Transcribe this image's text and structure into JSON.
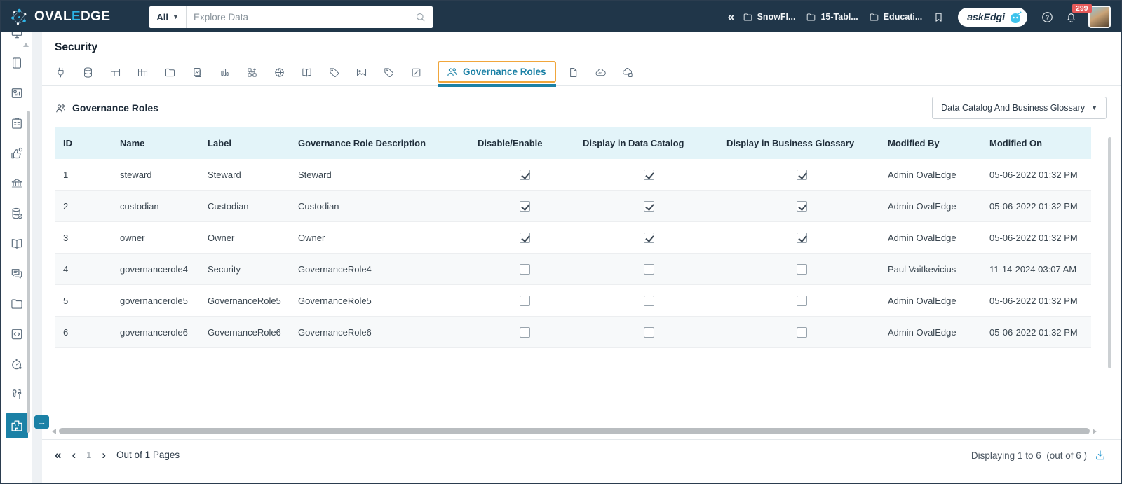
{
  "colors": {
    "navbar_bg": "#203649",
    "accent_cyan": "#2cb5e8",
    "accent_teal": "#1b81a6",
    "highlight_orange": "#f0a63c",
    "badge_red": "#e65a5a",
    "table_header_bg": "#e3f4f9"
  },
  "navbar": {
    "brand": {
      "part1": "OVAL",
      "accent": "E",
      "part2": "DGE"
    },
    "search": {
      "scope_label": "All",
      "placeholder": "Explore Data"
    },
    "recent_items": [
      "SnowFl...",
      "15-Tabl...",
      "Educati..."
    ],
    "ask_edgi_label": "askEdgi",
    "notification_count": "299"
  },
  "page": {
    "title": "Security"
  },
  "tabstrip": {
    "active_tab": "Governance Roles",
    "icons_before": [
      "connector",
      "database",
      "table",
      "table-columns",
      "folder",
      "report",
      "bar-chart",
      "hierarchy",
      "globe",
      "book",
      "tag",
      "image",
      "label",
      "edit-box"
    ],
    "icons_after": [
      "file",
      "cloud-api",
      "cloud-copy"
    ]
  },
  "section": {
    "title": "Governance Roles",
    "view_dropdown": "Data Catalog And Business Glossary"
  },
  "table": {
    "columns": [
      "ID",
      "Name",
      "Label",
      "Governance Role Description",
      "Disable/Enable",
      "Display in Data Catalog",
      "Display in Business Glossary",
      "Modified By",
      "Modified On"
    ],
    "rows": [
      {
        "id": "1",
        "name": "steward",
        "label": "Steward",
        "description": "Steward",
        "disable_enable": true,
        "display_in_data_catalog": true,
        "display_in_business_glossary": true,
        "modified_by": "Admin OvalEdge",
        "modified_on": "05-06-2022 01:32 PM"
      },
      {
        "id": "2",
        "name": "custodian",
        "label": "Custodian",
        "description": "Custodian",
        "disable_enable": true,
        "display_in_data_catalog": true,
        "display_in_business_glossary": true,
        "modified_by": "Admin OvalEdge",
        "modified_on": "05-06-2022 01:32 PM"
      },
      {
        "id": "3",
        "name": "owner",
        "label": "Owner",
        "description": "Owner",
        "disable_enable": true,
        "display_in_data_catalog": true,
        "display_in_business_glossary": true,
        "modified_by": "Admin OvalEdge",
        "modified_on": "05-06-2022 01:32 PM"
      },
      {
        "id": "4",
        "name": "governancerole4",
        "label": "Security",
        "description": "GovernanceRole4",
        "disable_enable": false,
        "display_in_data_catalog": false,
        "display_in_business_glossary": false,
        "modified_by": "Paul Vaitkevicius",
        "modified_on": "11-14-2024 03:07 AM"
      },
      {
        "id": "5",
        "name": "governancerole5",
        "label": "GovernanceRole5",
        "description": "GovernanceRole5",
        "disable_enable": false,
        "display_in_data_catalog": false,
        "display_in_business_glossary": false,
        "modified_by": "Admin OvalEdge",
        "modified_on": "05-06-2022 01:32 PM"
      },
      {
        "id": "6",
        "name": "governancerole6",
        "label": "GovernanceRole6",
        "description": "GovernanceRole6",
        "disable_enable": false,
        "display_in_data_catalog": false,
        "display_in_business_glossary": false,
        "modified_by": "Admin OvalEdge",
        "modified_on": "05-06-2022 01:32 PM"
      }
    ]
  },
  "footer": {
    "page_number": "1",
    "pages_text": "Out of 1 Pages",
    "display_text": "Displaying 1 to 6  (out of 6 )"
  },
  "sidebar": {
    "icons": [
      "screen",
      "notebook",
      "dashboard",
      "clipboard",
      "approval",
      "bank",
      "database-check",
      "open-book",
      "chat",
      "folder",
      "code",
      "timer",
      "tools",
      "building"
    ],
    "active_icon": "building"
  }
}
